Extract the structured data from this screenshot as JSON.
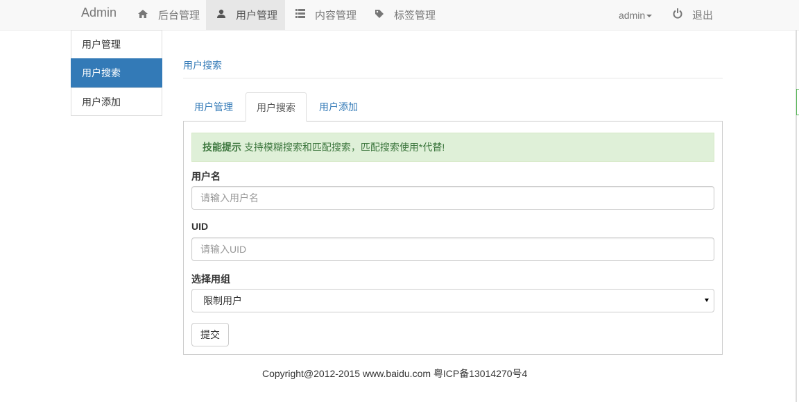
{
  "navbar": {
    "brand": "Admin",
    "items": [
      {
        "label": "后台管理",
        "icon": "home-icon"
      },
      {
        "label": "用户管理",
        "icon": "user-icon",
        "active": true
      },
      {
        "label": "内容管理",
        "icon": "list-icon"
      },
      {
        "label": "标签管理",
        "icon": "tag-icon"
      }
    ],
    "user_menu": "admin",
    "logout": {
      "label": "退出",
      "icon": "power-icon"
    }
  },
  "sidebar": {
    "items": [
      {
        "label": "用户管理"
      },
      {
        "label": "用户搜索",
        "active": true
      },
      {
        "label": "用户添加"
      }
    ]
  },
  "main": {
    "heading": "用户搜索",
    "tabs": [
      {
        "label": "用户管理"
      },
      {
        "label": "用户搜索",
        "active": true
      },
      {
        "label": "用户添加"
      }
    ],
    "alert": {
      "title": "技能提示",
      "text": " 支持模糊搜索和匹配搜索，匹配搜索使用*代替!"
    },
    "form": {
      "username_label": "用户名",
      "username_placeholder": "请输入用户名",
      "uid_label": "UID",
      "uid_placeholder": "请输入UID",
      "group_label": "选择用组",
      "group_selected": "限制用户",
      "submit": "提交"
    }
  },
  "footer": "Copyright@2012-2015 www.baidu.com 粤ICP备13014270号4",
  "colors": {
    "primary": "#337ab7",
    "alert_bg": "#dff0d8",
    "alert_text": "#3c763d",
    "navbar_bg": "#f8f8f8"
  }
}
